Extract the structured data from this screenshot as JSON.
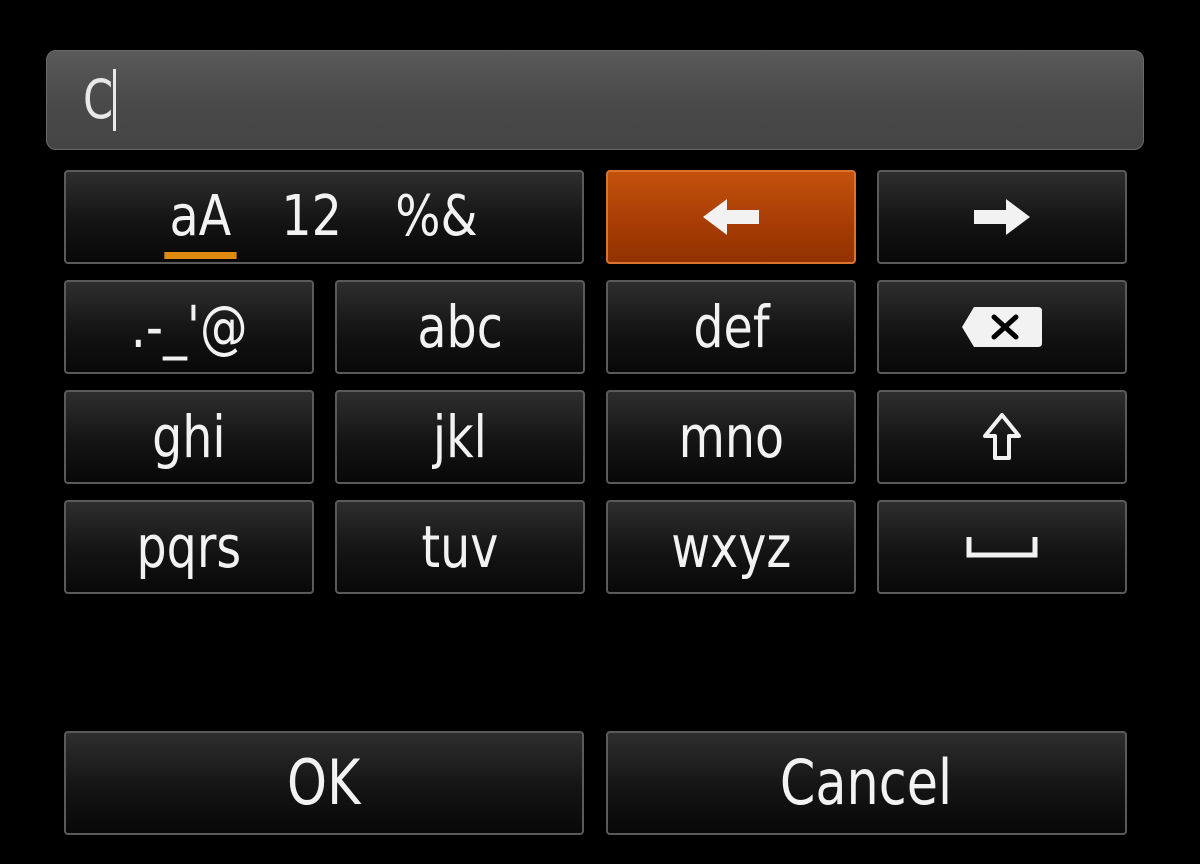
{
  "text_input": {
    "value": "C"
  },
  "mode_selector": {
    "modes": [
      "aA",
      "12",
      "%&"
    ],
    "active_mode": "aA"
  },
  "nav": {
    "cursor_left_icon": "arrow-left-icon",
    "cursor_right_icon": "arrow-right-icon"
  },
  "keypad": {
    "row1": [
      ".-_'@",
      "abc",
      "def"
    ],
    "row2": [
      "ghi",
      "jkl",
      "mno"
    ],
    "row3": [
      "pqrs",
      "tuv",
      "wxyz"
    ],
    "side_icons": [
      "backspace-icon",
      "shift-icon",
      "space-icon"
    ]
  },
  "actions": {
    "ok_label": "OK",
    "cancel_label": "Cancel"
  },
  "colors": {
    "background": "#000000",
    "selected_key": "#b8480a",
    "mode_underline": "#e08a12",
    "text_field": "#4e4e4e"
  }
}
